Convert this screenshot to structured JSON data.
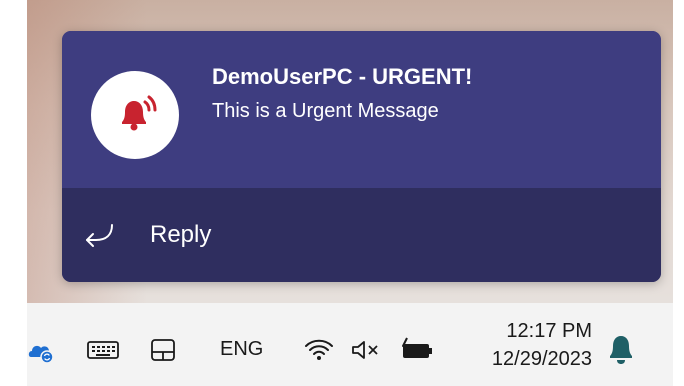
{
  "notification": {
    "title": "DemoUserPC - URGENT!",
    "message": "This is a Urgent Message",
    "icon": "urgent-bell-icon",
    "reply_label": "Reply"
  },
  "taskbar": {
    "language": "ENG",
    "time": "12:17 PM",
    "date": "12/29/2023",
    "icons": [
      "onedrive-sync-icon",
      "keyboard-icon",
      "tablet-mode-icon",
      "wifi-icon",
      "volume-muted-icon",
      "battery-charging-icon",
      "notification-bell-icon"
    ]
  },
  "colors": {
    "toast_body": "#3e3d80",
    "toast_footer": "#2f2e5f",
    "urgent_red": "#c8232f",
    "bell_teal": "#1f5f66"
  }
}
